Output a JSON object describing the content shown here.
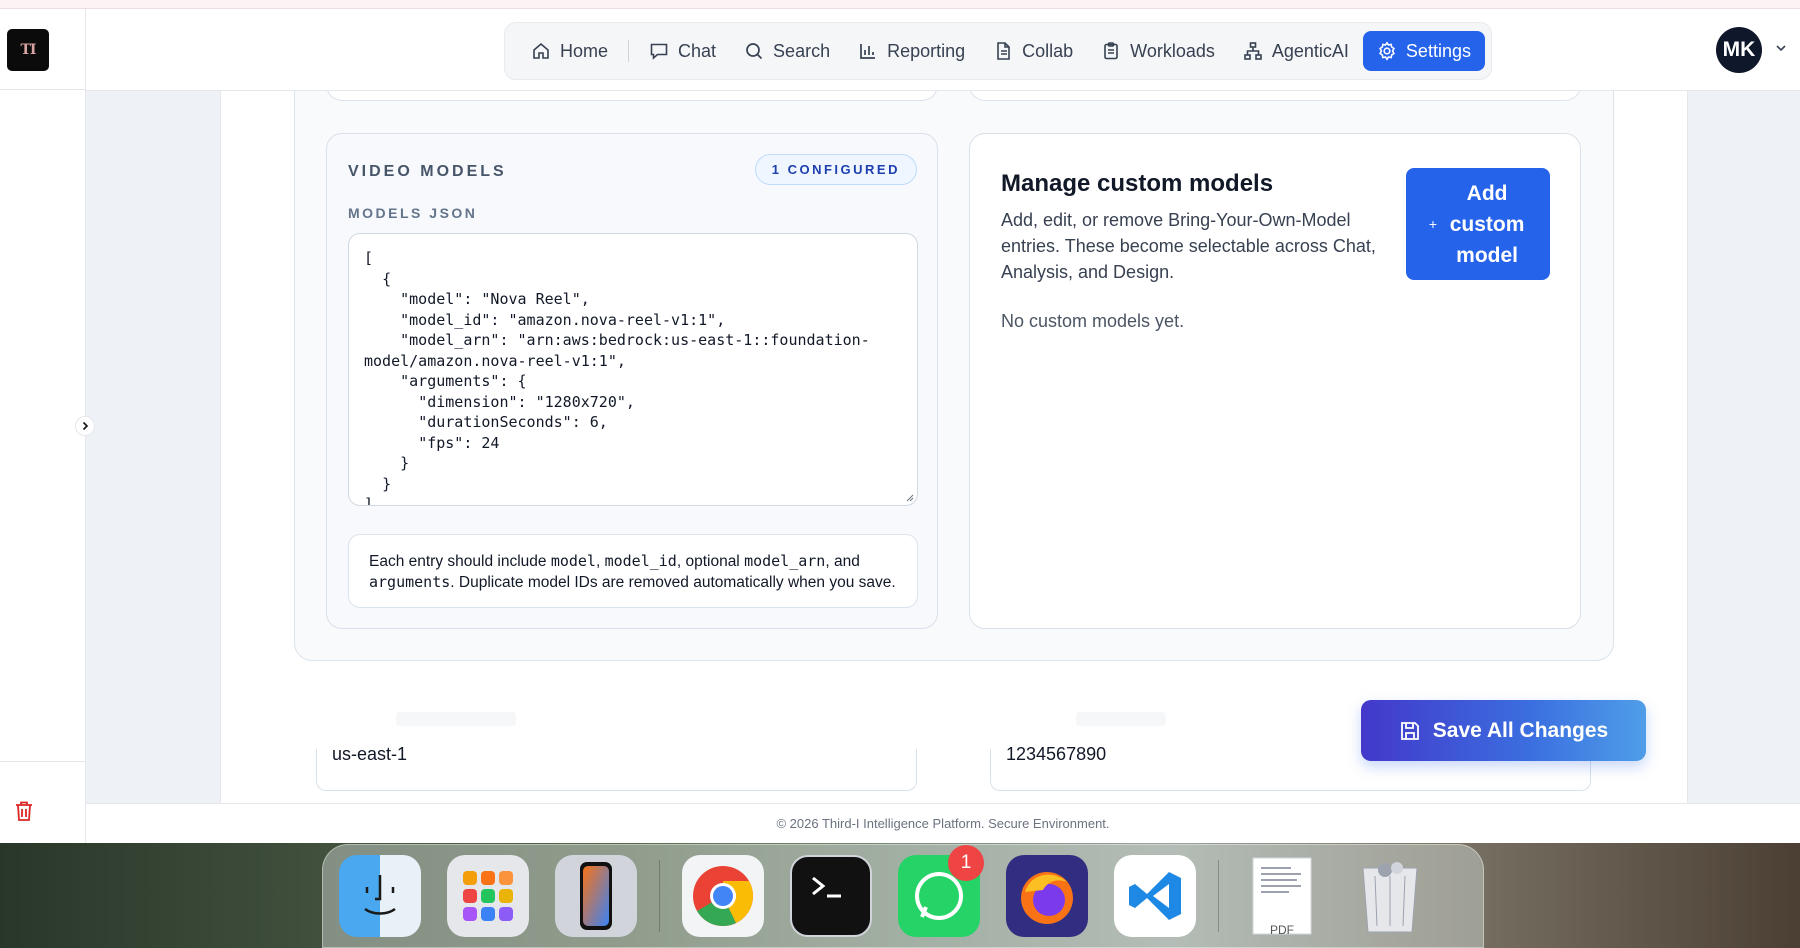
{
  "app": {
    "logo_text": "TI",
    "user_initials": "MK"
  },
  "nav": {
    "items": [
      {
        "label": "Home",
        "icon": "home-icon"
      },
      {
        "label": "Chat",
        "icon": "chat-icon"
      },
      {
        "label": "Search",
        "icon": "search-icon"
      },
      {
        "label": "Reporting",
        "icon": "bar-chart-icon"
      },
      {
        "label": "Collab",
        "icon": "document-icon"
      },
      {
        "label": "Workloads",
        "icon": "clipboard-icon"
      },
      {
        "label": "AgenticAI",
        "icon": "network-icon"
      },
      {
        "label": "Settings",
        "icon": "gear-icon",
        "active": true
      }
    ]
  },
  "video_models": {
    "title": "VIDEO MODELS",
    "badge": "1 CONFIGURED",
    "json_label": "MODELS JSON",
    "json_value": "[\n  {\n    \"model\": \"Nova Reel\",\n    \"model_id\": \"amazon.nova-reel-v1:1\",\n    \"model_arn\": \"arn:aws:bedrock:us-east-1::foundation-model/amazon.nova-reel-v1:1\",\n    \"arguments\": {\n      \"dimension\": \"1280x720\",\n      \"durationSeconds\": 6,\n      \"fps\": 24\n    }\n  }\n]",
    "hint": {
      "prefix": "Each entry should include ",
      "code1": "model",
      "sep1": ", ",
      "code2": "model_id",
      "sep2": ", optional ",
      "code3": "model_arn",
      "sep3": ", and ",
      "code4": "arguments",
      "suffix": ". Duplicate model IDs are removed automatically when you save."
    }
  },
  "custom_models": {
    "title": "Manage custom models",
    "description": "Add, edit, or remove Bring-Your-Own-Model entries. These become selectable across Chat, Analysis, and Design.",
    "empty_text": "No custom models yet.",
    "add_button_plus": "+",
    "add_button_label": "Add custom model"
  },
  "lower_fields": {
    "region_value": "us-east-1",
    "account_value": "1234567890"
  },
  "save_button": "Save All Changes",
  "footer": "© 2026 Third-I Intelligence Platform. Secure Environment.",
  "dock": {
    "apps": [
      "Finder",
      "Launchpad",
      "iPhone Mirroring",
      "Chrome",
      "Terminal",
      "WhatsApp",
      "Firefox",
      "VS Code",
      "PDF",
      "Trash"
    ],
    "whatsapp_badge": "1",
    "pdf_label": "PDF"
  },
  "colors": {
    "accent": "#2563eb",
    "save_gradient_start": "#4338ca",
    "save_gradient_end": "#4f9ee8",
    "badge_red": "#ef4444"
  }
}
